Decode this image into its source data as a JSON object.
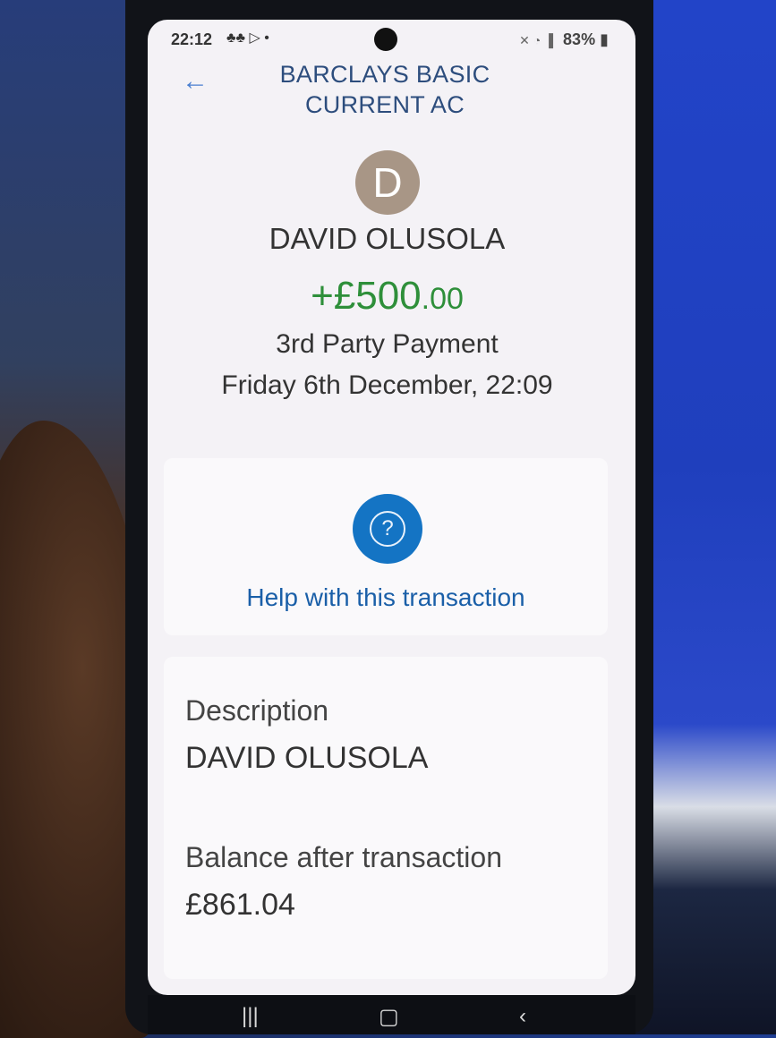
{
  "status_bar": {
    "time": "22:12",
    "notif_icons": "♣♣ ▷ •",
    "battery": "83%"
  },
  "header": {
    "back_icon": "arrow-left-icon",
    "title": "BARCLAYS BASIC CURRENT AC"
  },
  "transaction": {
    "avatar_letter": "D",
    "payee": "DAVID OLUSOLA",
    "amount_main": "+£500",
    "amount_pence": ".00",
    "type": "3rd Party Payment",
    "date": "Friday 6th December, 22:09"
  },
  "help": {
    "icon": "question-icon",
    "label": "Help with this transaction"
  },
  "details": {
    "description_label": "Description",
    "description_value": "DAVID OLUSOLA",
    "balance_label": "Balance after transaction",
    "balance_value": "£861.04"
  },
  "colors": {
    "amount_green": "#2e8f3a",
    "link_blue": "#1a5fa8",
    "help_button_blue": "#1474c4",
    "title_navy": "#2d4d7d"
  }
}
